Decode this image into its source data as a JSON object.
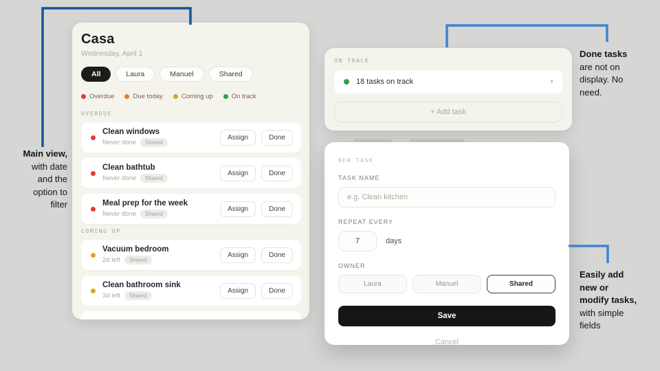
{
  "annotations": {
    "left": {
      "lines": [
        "Main view,",
        "with date",
        "and the",
        "option to",
        "filter"
      ]
    },
    "right_top": {
      "lines": [
        "Done tasks",
        "are not on",
        "display. No",
        "need."
      ]
    },
    "right_bottom": {
      "lines": [
        "Easily add",
        "new or",
        "modify tasks,",
        "with simple",
        "fields"
      ]
    }
  },
  "connectors": {
    "left_color": "#15549b",
    "right_color": "#3d84d0"
  },
  "main_panel": {
    "title": "Casa",
    "date": "Wednesday, April 1",
    "filters": [
      {
        "label": "All",
        "active": true
      },
      {
        "label": "Laura",
        "active": false
      },
      {
        "label": "Manuel",
        "active": false
      },
      {
        "label": "Shared",
        "active": false
      }
    ],
    "legend": [
      {
        "label": "Overdue",
        "color": "#e23b3b"
      },
      {
        "label": "Due today",
        "color": "#f07820"
      },
      {
        "label": "Coming up",
        "color": "#dfa51c"
      },
      {
        "label": "On track",
        "color": "#2e9e44"
      }
    ],
    "assign_label": "Assign",
    "done_label": "Done",
    "sections": [
      {
        "header": "OVERDUE",
        "tasks": [
          {
            "title": "Clean windows",
            "meta": "Never done",
            "badge": "Shared",
            "dot": "#e23b3b"
          },
          {
            "title": "Clean bathtub",
            "meta": "Never done",
            "badge": "Shared",
            "dot": "#e23b3b"
          },
          {
            "title": "Meal prep for the week",
            "meta": "Never done",
            "badge": "Shared",
            "dot": "#e23b3b"
          }
        ]
      },
      {
        "header": "COMING UP",
        "tasks": [
          {
            "title": "Vacuum bedroom",
            "meta": "2d left",
            "badge": "Shared",
            "dot": "#dfa51c"
          },
          {
            "title": "Clean bathroom sink",
            "meta": "3d left",
            "badge": "Shared",
            "dot": "#dfa51c"
          }
        ]
      }
    ]
  },
  "on_track_panel": {
    "header": "ON TRACK",
    "summary": "18 tasks on track",
    "dot_color": "#2e9e44",
    "caret": "▼",
    "add_task_label": "+ Add task"
  },
  "modal": {
    "header": "NEW TASK",
    "task_name_label": "TASK NAME",
    "task_name_placeholder": "e.g. Clean kitchen",
    "repeat_label": "REPEAT EVERY",
    "repeat_value": "7",
    "repeat_unit": "days",
    "owner_label": "OWNER",
    "owners": [
      {
        "label": "Laura",
        "selected": false
      },
      {
        "label": "Manuel",
        "selected": false
      },
      {
        "label": "Shared",
        "selected": true
      }
    ],
    "save_label": "Save",
    "cancel_label": "Cancel"
  }
}
